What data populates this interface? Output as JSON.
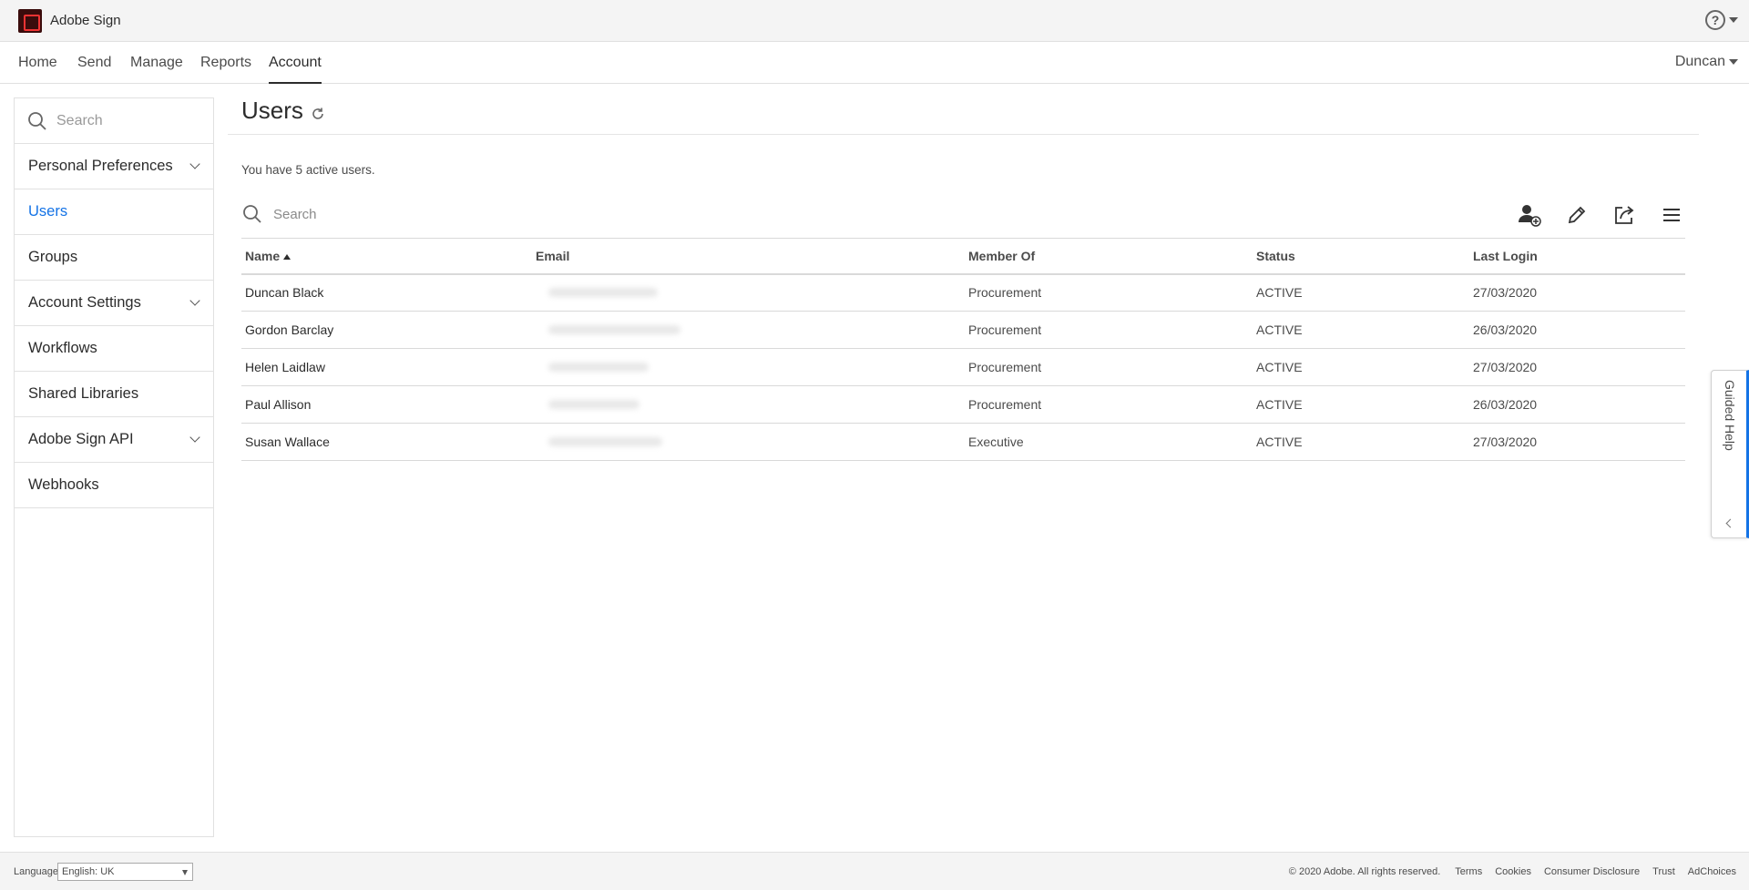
{
  "app": {
    "title": "Adobe Sign"
  },
  "nav": {
    "tabs": [
      {
        "label": "Home"
      },
      {
        "label": "Send"
      },
      {
        "label": "Manage"
      },
      {
        "label": "Reports"
      },
      {
        "label": "Account"
      }
    ],
    "active_tab": "Account",
    "user": "Duncan"
  },
  "sidebar": {
    "search_placeholder": "Search",
    "items": [
      {
        "label": "Personal Preferences",
        "expandable": true
      },
      {
        "label": "Users",
        "active": true
      },
      {
        "label": "Groups"
      },
      {
        "label": "Account Settings",
        "expandable": true
      },
      {
        "label": "Workflows"
      },
      {
        "label": "Shared Libraries"
      },
      {
        "label": "Adobe Sign API",
        "expandable": true
      },
      {
        "label": "Webhooks"
      }
    ]
  },
  "main": {
    "title": "Users",
    "active_count_text": "You have 5 active users.",
    "search_placeholder": "Search",
    "toolbar_icons": [
      "add-user-icon",
      "edit-icon",
      "export-icon",
      "menu-icon"
    ],
    "table": {
      "columns": [
        "Name",
        "Email",
        "Member Of",
        "Status",
        "Last Login"
      ],
      "sorted_by": "Name",
      "rows": [
        {
          "name": "Duncan Black",
          "member_of": "Procurement",
          "status": "ACTIVE",
          "last_login": "27/03/2020"
        },
        {
          "name": "Gordon Barclay",
          "member_of": "Procurement",
          "status": "ACTIVE",
          "last_login": "26/03/2020"
        },
        {
          "name": "Helen Laidlaw",
          "member_of": "Procurement",
          "status": "ACTIVE",
          "last_login": "27/03/2020"
        },
        {
          "name": "Paul Allison",
          "member_of": "Procurement",
          "status": "ACTIVE",
          "last_login": "26/03/2020"
        },
        {
          "name": "Susan Wallace",
          "member_of": "Executive",
          "status": "ACTIVE",
          "last_login": "27/03/2020"
        }
      ]
    }
  },
  "guided_help": {
    "label": "Guided Help"
  },
  "footer": {
    "language_label": "Language",
    "language_value": "English: UK",
    "copyright": "© 2020 Adobe. All rights reserved.",
    "links": [
      "Terms",
      "Cookies",
      "Consumer Disclosure",
      "Trust",
      "AdChoices"
    ]
  },
  "colors": {
    "accent": "#1473e6",
    "text": "#2c2c2c",
    "border": "#e1e1e1"
  }
}
